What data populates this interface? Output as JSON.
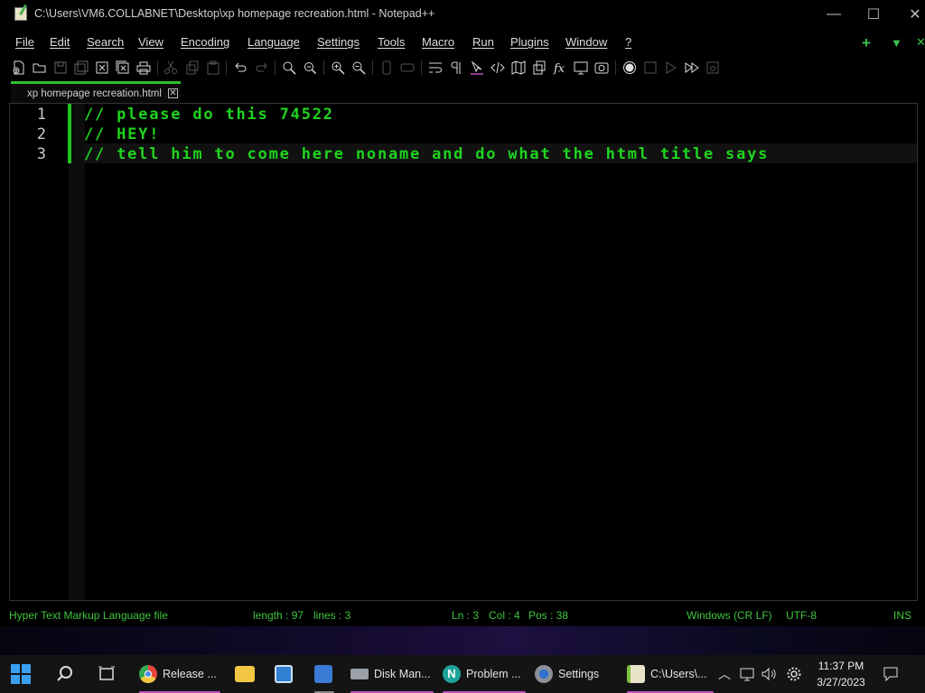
{
  "window": {
    "title": "C:\\Users\\VM6.COLLABNET\\Desktop\\xp homepage recreation.html - Notepad++",
    "controls": {
      "minimize": "—",
      "maximize": "☐",
      "close": "✕"
    }
  },
  "menu": {
    "items": [
      "File",
      "Edit",
      "Search",
      "View",
      "Encoding",
      "Language",
      "Settings",
      "Tools",
      "Macro",
      "Run",
      "Plugins",
      "Window",
      "?"
    ],
    "extra": {
      "plus": "+",
      "down": "▼",
      "close": "✕"
    }
  },
  "toolbar": {
    "icons": [
      "new-file-icon",
      "open-file-icon",
      "save-icon",
      "save-all-icon",
      "close-icon",
      "close-all-icon",
      "print-icon",
      "cut-icon",
      "copy-icon",
      "paste-icon",
      "undo-icon",
      "redo-icon",
      "find-icon",
      "replace-icon",
      "zoom-in-icon",
      "zoom-out-icon",
      "sync-vertical-icon",
      "sync-horizontal-icon",
      "word-wrap-icon",
      "show-all-chars-icon",
      "indent-guide-icon",
      "udl-icon",
      "doc-map-icon",
      "doc-list-icon",
      "function-list-icon",
      "folder-workspace-icon",
      "monitoring-icon",
      "record-macro-icon",
      "stop-record-icon",
      "playback-icon",
      "run-macro-multiple-icon",
      "save-macro-icon"
    ]
  },
  "tab": {
    "label": "xp homepage recreation.html",
    "close": "✕"
  },
  "editor": {
    "lines": [
      {
        "num": "1",
        "text": "// please do this 74522"
      },
      {
        "num": "2",
        "text": "// HEY!"
      },
      {
        "num": "3",
        "text": "// tell him to come here noname and do what the html title says"
      }
    ]
  },
  "status": {
    "filetype": "Hyper Text Markup Language file",
    "length": "length : 97",
    "lines": "lines : 3",
    "ln": "Ln : 3",
    "col": "Col : 4",
    "pos": "Pos : 38",
    "eol": "Windows (CR LF)",
    "encoding": "UTF-8",
    "mode": "INS"
  },
  "taskbar": {
    "items": [
      {
        "label": "Release ...",
        "icon": "chrome-icon",
        "color": "#e8453c"
      },
      {
        "label": "",
        "icon": "file-explorer-icon",
        "color": "#f2c744"
      },
      {
        "label": "",
        "icon": "app-window-icon",
        "color": "#2f7fd3"
      },
      {
        "label": "",
        "icon": "app-network-icon",
        "color": "#3a7bd5"
      },
      {
        "label": "Disk Man...",
        "icon": "disk-management-icon",
        "color": "#9aa0a6"
      },
      {
        "label": "Problem ...",
        "icon": "problem-steps-icon",
        "color": "#1fa39a"
      },
      {
        "label": "Settings",
        "icon": "settings-icon",
        "color": "#8a8f98"
      },
      {
        "label": "C:\\Users\\...",
        "icon": "notepadpp-icon",
        "color": "#7dc242"
      }
    ],
    "time": "11:37 PM",
    "date": "3/27/2023"
  }
}
